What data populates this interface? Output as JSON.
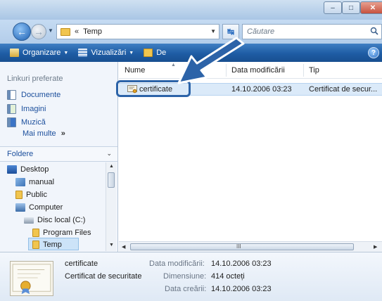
{
  "window": {
    "caption_buttons": {
      "minimize": "–",
      "maximize": "□",
      "close": "✕"
    }
  },
  "address": {
    "separator": "«",
    "path": "Temp",
    "search_placeholder": "Căutare"
  },
  "toolbar": {
    "organize": "Organizare",
    "views": "Vizualizări",
    "burn": "De",
    "help": "?"
  },
  "sidebar": {
    "favorites_title": "Linkuri preferate",
    "favorites": [
      {
        "label": "Documente",
        "icon": "documents-icon"
      },
      {
        "label": "Imagini",
        "icon": "pictures-icon"
      },
      {
        "label": "Muzică",
        "icon": "music-icon"
      }
    ],
    "more": "Mai multe",
    "more_glyph": "»",
    "folders_title": "Foldere",
    "tree": [
      {
        "label": "Desktop",
        "icon": "desktop-icon"
      },
      {
        "label": "manual",
        "icon": "user-folder-icon"
      },
      {
        "label": "Public",
        "icon": "folder-icon"
      },
      {
        "label": "Computer",
        "icon": "computer-icon"
      },
      {
        "label": "Disc local (C:)",
        "icon": "drive-icon"
      },
      {
        "label": "Program Files",
        "icon": "folder-icon"
      },
      {
        "label": "Temp",
        "icon": "folder-icon"
      }
    ]
  },
  "list": {
    "columns": [
      "Nume",
      "Data modificării",
      "Tip"
    ],
    "rows": [
      {
        "name": "certificate",
        "modified": "14.10.2006 03:23",
        "type": "Certificat de secur..."
      }
    ],
    "hscroll_grip": "III"
  },
  "details": {
    "name": "certificate",
    "type": "Certificat de securitate",
    "modified_label": "Data modificării:",
    "modified_value": "14.10.2006 03:23",
    "size_label": "Dimensiune:",
    "size_value": "414 octeți",
    "created_label": "Data creării:",
    "created_value": "14.10.2006 03:23"
  },
  "colors": {
    "toolbar": "#1e5ca4",
    "selection": "#dbeaf9",
    "callout": "#2c63a8"
  }
}
